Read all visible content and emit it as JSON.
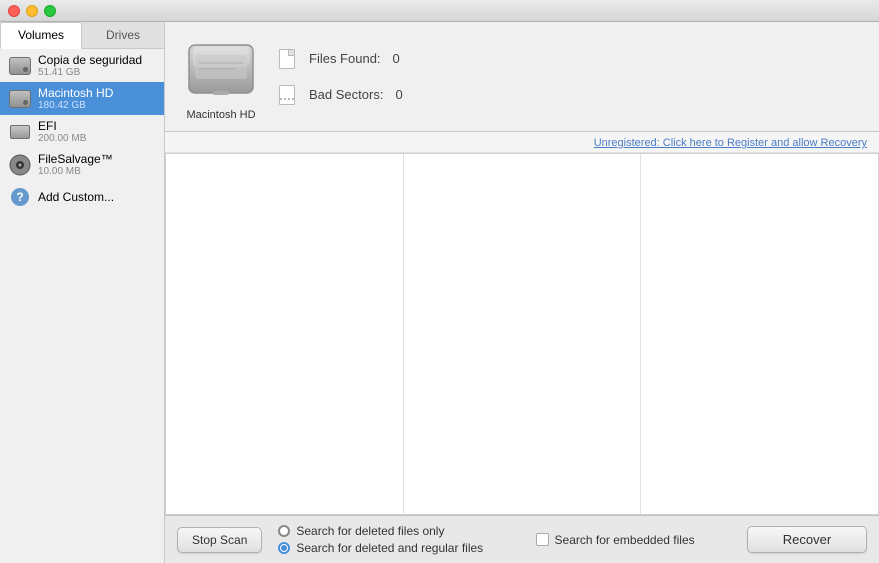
{
  "titlebar": {
    "traffic_lights": [
      "red",
      "yellow",
      "green"
    ]
  },
  "sidebar": {
    "tabs": [
      {
        "id": "volumes",
        "label": "Volumes",
        "active": true
      },
      {
        "id": "drives",
        "label": "Drives",
        "active": false
      }
    ],
    "items": [
      {
        "id": "copia",
        "name": "Copia de seguridad",
        "size": "51.41 GB",
        "selected": false,
        "icon": "hd"
      },
      {
        "id": "macintosh",
        "name": "Macintosh HD",
        "size": "180.42 GB",
        "selected": true,
        "icon": "hd"
      },
      {
        "id": "efi",
        "name": "EFI",
        "size": "200.00 MB",
        "selected": false,
        "icon": "hd-small"
      },
      {
        "id": "filesalvage",
        "name": "FileSalvage™",
        "size": "10.00 MB",
        "selected": false,
        "icon": "disk"
      },
      {
        "id": "addcustom",
        "name": "Add Custom...",
        "size": "",
        "selected": false,
        "icon": "question"
      }
    ]
  },
  "drive_panel": {
    "drive_name": "Macintosh HD",
    "files_found_label": "Files Found:",
    "files_found_value": "0",
    "bad_sectors_label": "Bad Sectors:",
    "bad_sectors_value": "0"
  },
  "registration": {
    "link_text": "Unregistered: Click here to Register and allow Recovery"
  },
  "bottom_toolbar": {
    "stop_scan_label": "Stop Scan",
    "search_deleted_label": "Search for deleted files only",
    "search_deleted_and_regular_label": "Search for deleted and regular files",
    "search_embedded_label": "Search for embedded files",
    "recover_label": "Recover"
  }
}
